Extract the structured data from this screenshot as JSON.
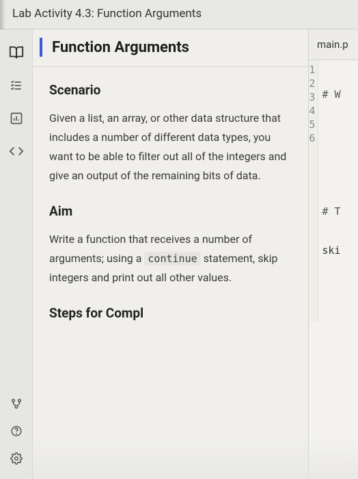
{
  "header": {
    "prefix": "Lab Activity 4.3:",
    "title": "Function Arguments"
  },
  "instructions": {
    "page_title": "Function Arguments",
    "scenario_heading": "Scenario",
    "scenario_body": "Given a list, an array, or other data structure that includes a number of different data types, you want to be able to filter out all of the integers and give an output of the remaining bits of data.",
    "aim_heading": "Aim",
    "aim_body_pre": "Write a function that receives a number of arguments; using a ",
    "aim_code": "continue",
    "aim_body_post": " statement, skip integers and print out all other values.",
    "steps_heading": "Steps for Compl"
  },
  "editor": {
    "tab_label": "main.p",
    "lines": [
      {
        "n": "1",
        "text": "# W"
      },
      {
        "n": "2",
        "text": ""
      },
      {
        "n": "3",
        "text": ""
      },
      {
        "n": "4",
        "text": "# T"
      },
      {
        "n": "5",
        "text": "ski"
      },
      {
        "n": "6",
        "text": ""
      }
    ]
  }
}
